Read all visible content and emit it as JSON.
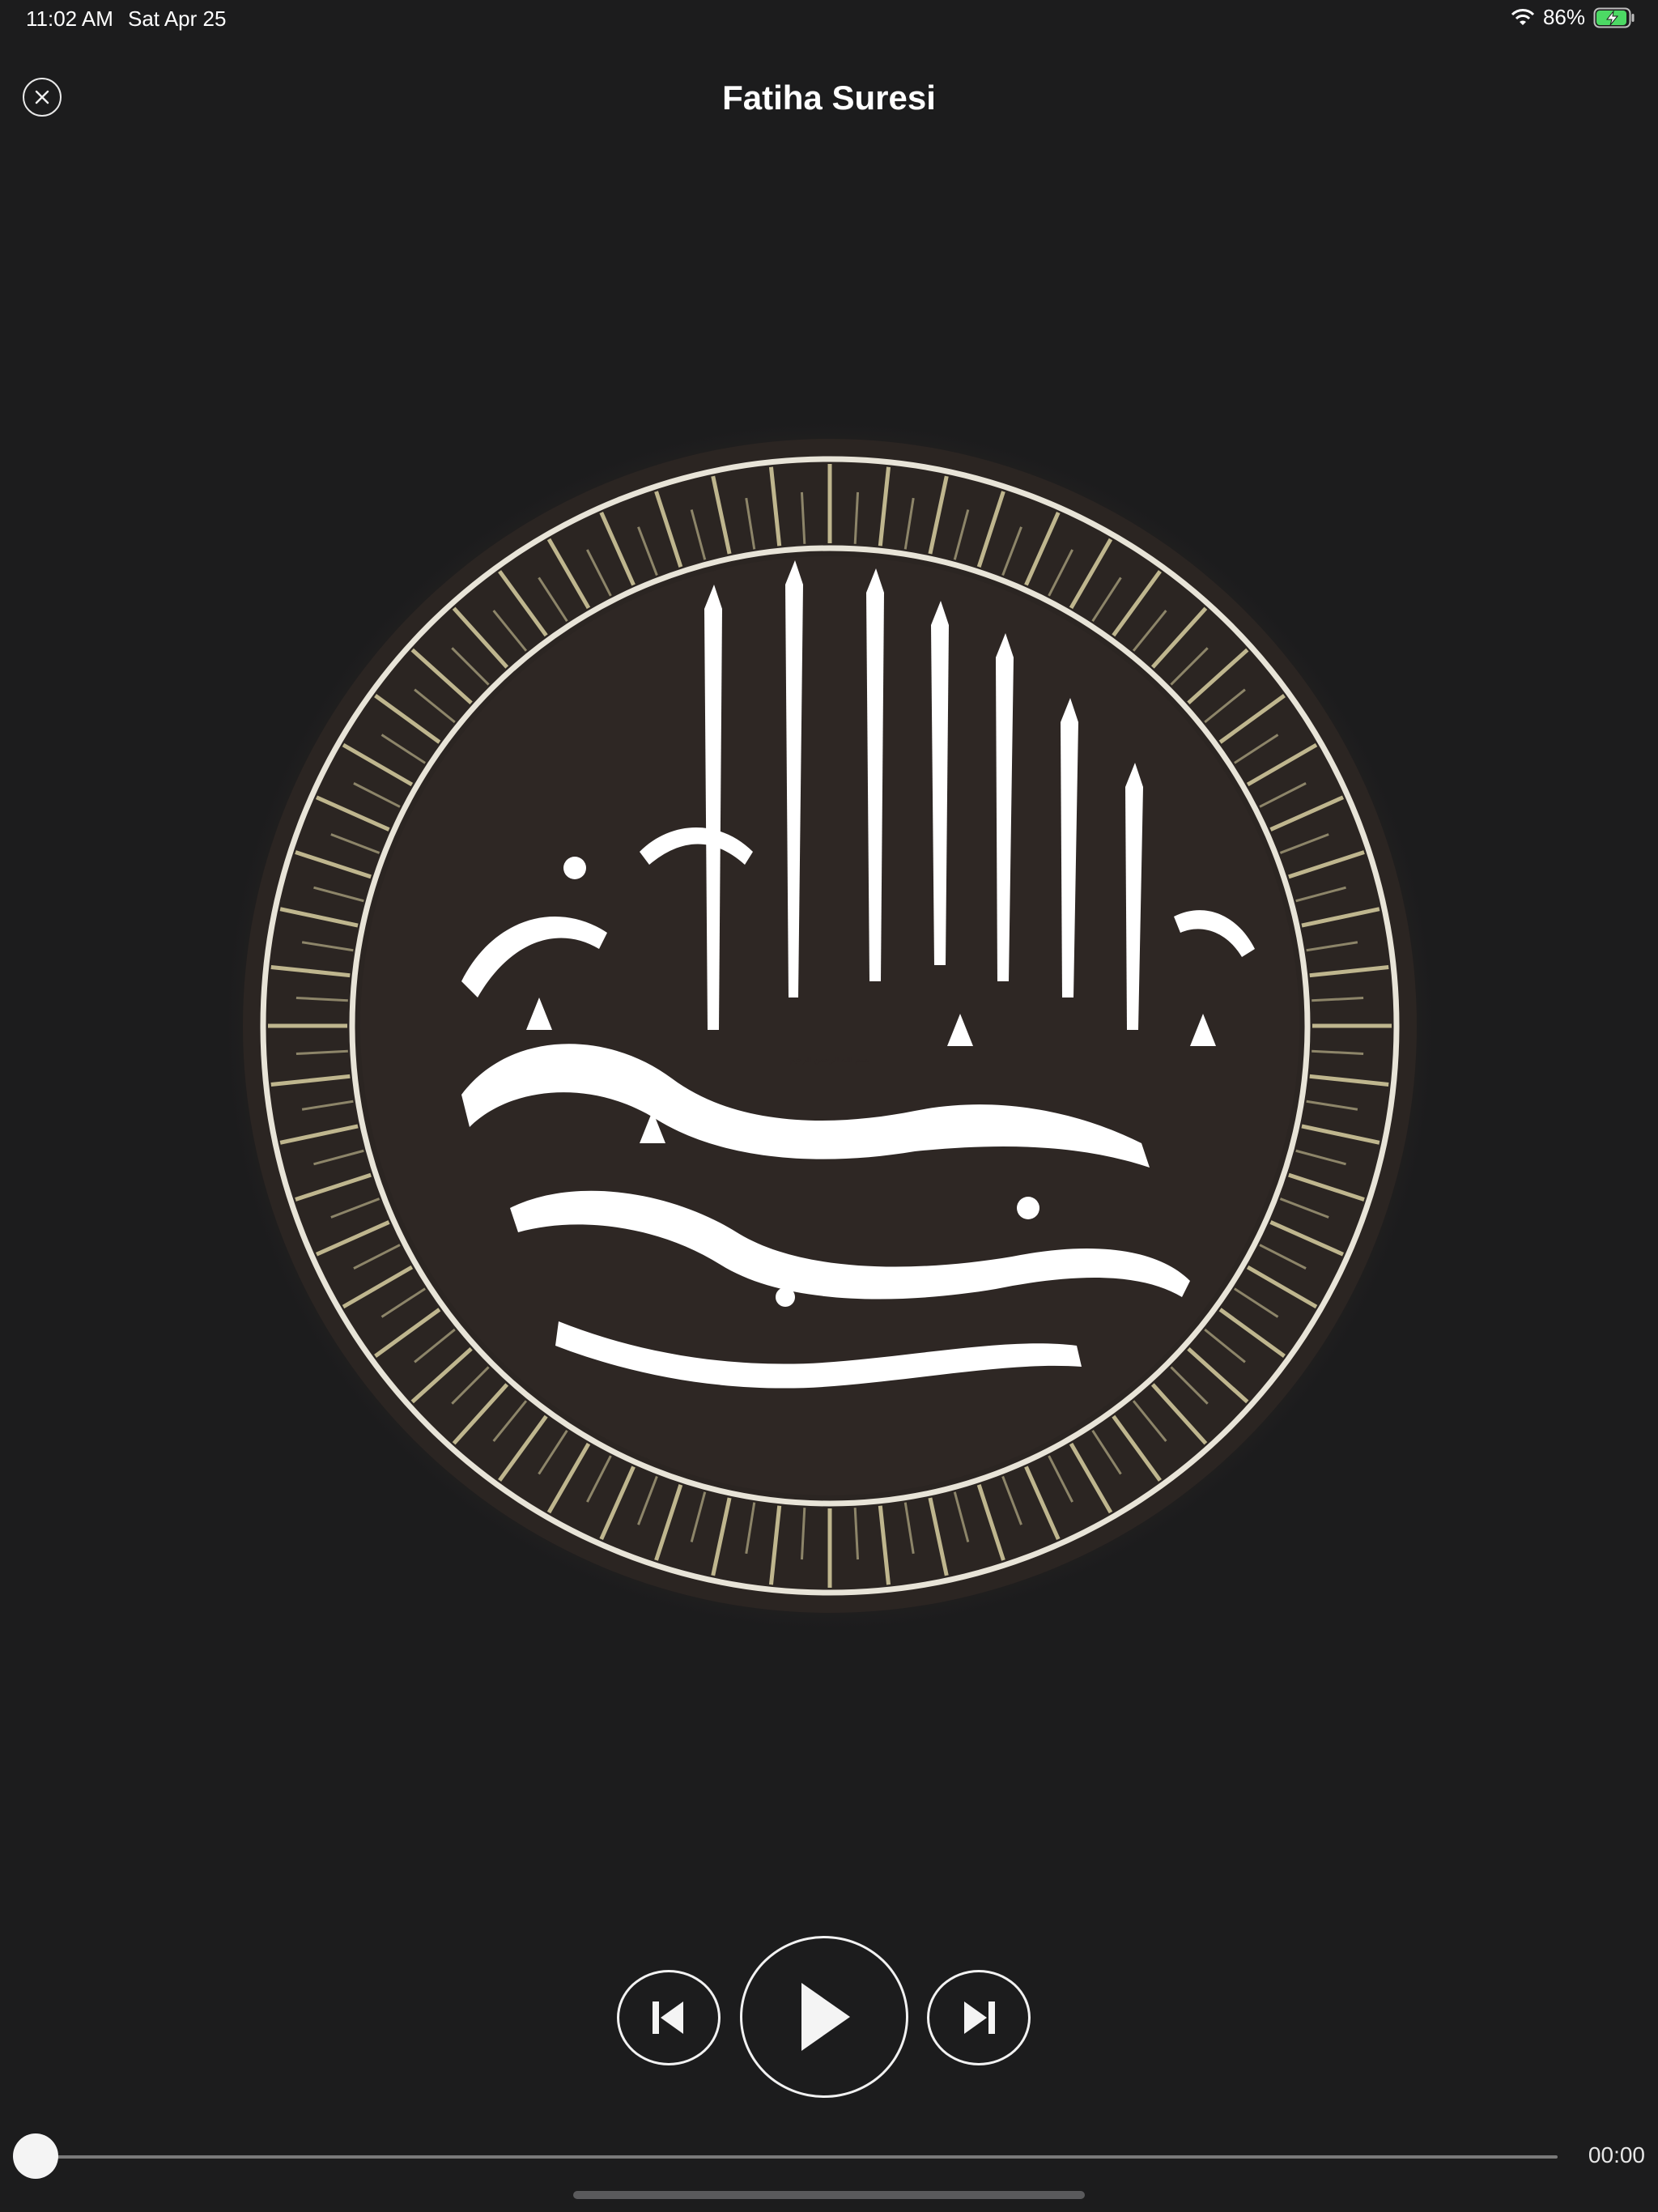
{
  "status_bar": {
    "time": "11:02 AM",
    "date": "Sat Apr 25",
    "battery_percent": "86%",
    "battery_level": 0.86,
    "icons": [
      "wifi-icon",
      "battery-charging-icon"
    ]
  },
  "header": {
    "title": "Fatiha Suresi",
    "close_icon": "close-icon"
  },
  "artwork": {
    "description_icon": "bismillah-calligraphy-medallion",
    "calligraphy_text": "بسم الله الرحمن الرحيم"
  },
  "player": {
    "prev_icon": "skip-previous-icon",
    "play_icon": "play-icon",
    "next_icon": "skip-next-icon",
    "progress": 0,
    "elapsed": "00:00"
  },
  "colors": {
    "background": "#1c1c1d",
    "medallion_dark": "#2e2724",
    "ray_gold": "#cfc79a",
    "foreground": "#ffffff"
  }
}
